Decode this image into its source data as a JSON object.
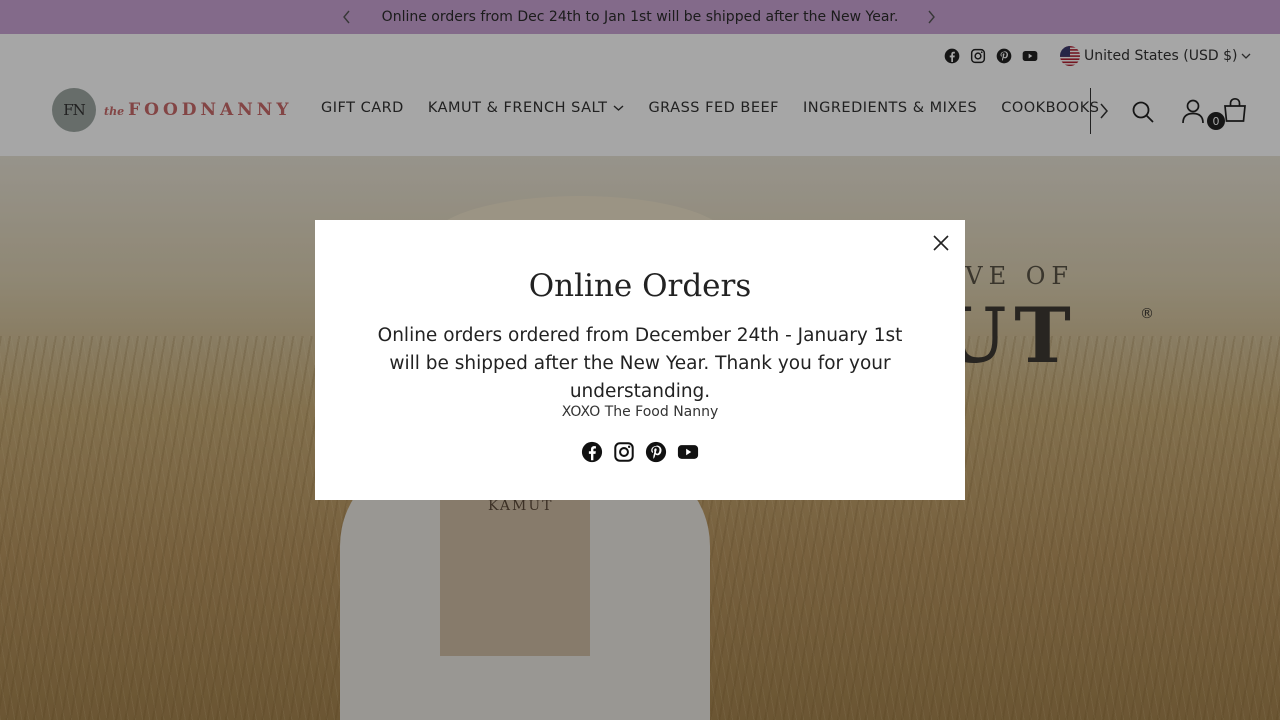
{
  "announcement": {
    "text": "Online orders from Dec 24th to Jan 1st will be shipped after the New Year.",
    "prev_icon": "chevron-left-icon",
    "next_icon": "chevron-right-icon",
    "background": "#c9a3d4"
  },
  "header": {
    "socials": [
      "facebook-icon",
      "instagram-icon",
      "pinterest-icon",
      "youtube-icon"
    ],
    "locale": "United States (USD $)",
    "logo": {
      "mark": "FN",
      "prefix": "the",
      "wordmark": "FOODNANNY"
    },
    "nav": [
      {
        "label": "GIFT CARD",
        "has_dropdown": false
      },
      {
        "label": "KAMUT & FRENCH SALT",
        "has_dropdown": true
      },
      {
        "label": "GRASS FED BEEF",
        "has_dropdown": false
      },
      {
        "label": "INGREDIENTS & MIXES",
        "has_dropdown": false
      },
      {
        "label": "COOKBOOKS",
        "has_dropdown": false
      }
    ],
    "cart_count": "0"
  },
  "hero": {
    "headline_small": "OVE OF",
    "headline_big": "UT",
    "book_title": "KAMUT"
  },
  "modal": {
    "title": "Online Orders",
    "body": "Online orders ordered from December 24th - January 1st will be shipped after the New Year. Thank you for your understanding.",
    "signature": "XOXO The Food Nanny",
    "socials": [
      "facebook-icon",
      "instagram-icon",
      "pinterest-icon",
      "youtube-icon"
    ]
  }
}
